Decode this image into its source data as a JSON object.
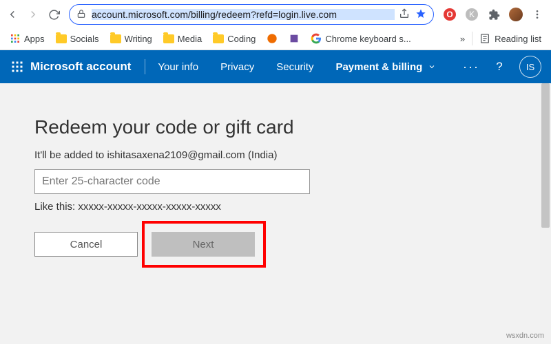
{
  "browser": {
    "url": "account.microsoft.com/billing/redeem?refd=login.live.com",
    "extensions": {
      "red_label": "O",
      "grey_label": "K"
    },
    "bookmarks": {
      "apps": "Apps",
      "items": [
        "Socials",
        "Writing",
        "Media",
        "Coding"
      ],
      "google_item": "Chrome keyboard s...",
      "reading_list": "Reading list"
    }
  },
  "header": {
    "brand": "Microsoft account",
    "nav": {
      "your_info": "Your info",
      "privacy": "Privacy",
      "security": "Security",
      "payment": "Payment & billing"
    },
    "more": "···",
    "help": "?",
    "user_initials": "IS"
  },
  "page": {
    "title": "Redeem your code or gift card",
    "subtitle": "It'll be added to ishitasaxena2109@gmail.com (India)",
    "code_placeholder": "Enter 25-character code",
    "hint": "Like this: xxxxx-xxxxx-xxxxx-xxxxx-xxxxx",
    "cancel": "Cancel",
    "next": "Next"
  },
  "watermark": "wsxdn.com"
}
